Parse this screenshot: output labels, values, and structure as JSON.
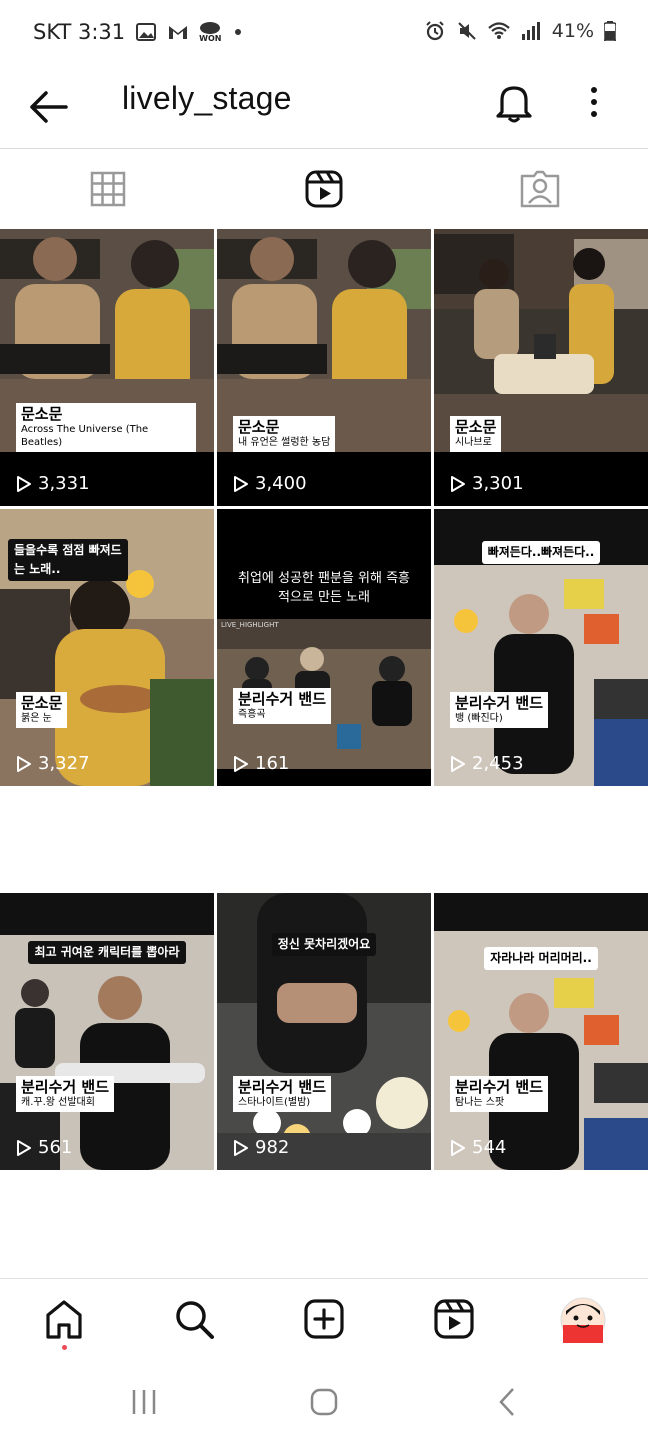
{
  "status_bar": {
    "carrier_time": "SKT 3:31",
    "won_label": "WON",
    "battery": "41%"
  },
  "header": {
    "title": "lively_stage",
    "icons": [
      "back-arrow-icon",
      "bell-icon",
      "more-vertical-icon"
    ]
  },
  "tabs": [
    {
      "name": "grid",
      "icon": "grid-icon"
    },
    {
      "name": "reels",
      "icon": "reels-icon",
      "selected": true
    },
    {
      "name": "tagged",
      "icon": "tagged-person-icon"
    }
  ],
  "reels": [
    {
      "title": "문소문",
      "subtitle": "Across The Universe (The Beatles)",
      "views": "3,331"
    },
    {
      "title": "문소문",
      "subtitle": "내 유언은 썰렁한 농담",
      "views": "3,400"
    },
    {
      "title": "문소문",
      "subtitle": "시나브로",
      "views": "3,301"
    },
    {
      "caption": "들을수록 점점 빠져드는 노래..",
      "title": "문소문",
      "subtitle": "붉은 눈",
      "views": "3,327"
    },
    {
      "caption": "취업에 성공한 팬분을 위해 즉흥적으로 만든 노래",
      "overlay_text": "LIVE_HIGHLIGHT",
      "title": "분리수거 밴드",
      "subtitle": "즉흥곡",
      "views": "161"
    },
    {
      "caption": "빠져든다..빠져든다..",
      "title": "분리수거 밴드",
      "subtitle": "뱅 (빠진다)",
      "views": "2,453"
    },
    {
      "caption": "최고 귀여운 캐릭터를 뽑아라",
      "title": "분리수거 밴드",
      "subtitle": "캐.꾸.왕 선발대회",
      "views": "561"
    },
    {
      "caption": "정신 못차리겠어요",
      "title": "분리수거 밴드",
      "subtitle": "스타나이트(별밤)",
      "views": "982"
    },
    {
      "caption": "자라나라 머리머리..",
      "title": "분리수거 밴드",
      "subtitle": "탐나는 스팟",
      "views": "544"
    }
  ],
  "bottom_nav": [
    {
      "name": "home",
      "icon": "home-icon"
    },
    {
      "name": "search",
      "icon": "search-icon"
    },
    {
      "name": "create",
      "icon": "plus-square-icon"
    },
    {
      "name": "reels",
      "icon": "reels-icon"
    },
    {
      "name": "profile",
      "icon": "avatar"
    }
  ],
  "colors": {
    "notification_dot": "#ed4956",
    "text": "#111111",
    "divider": "#dbdbdb"
  }
}
